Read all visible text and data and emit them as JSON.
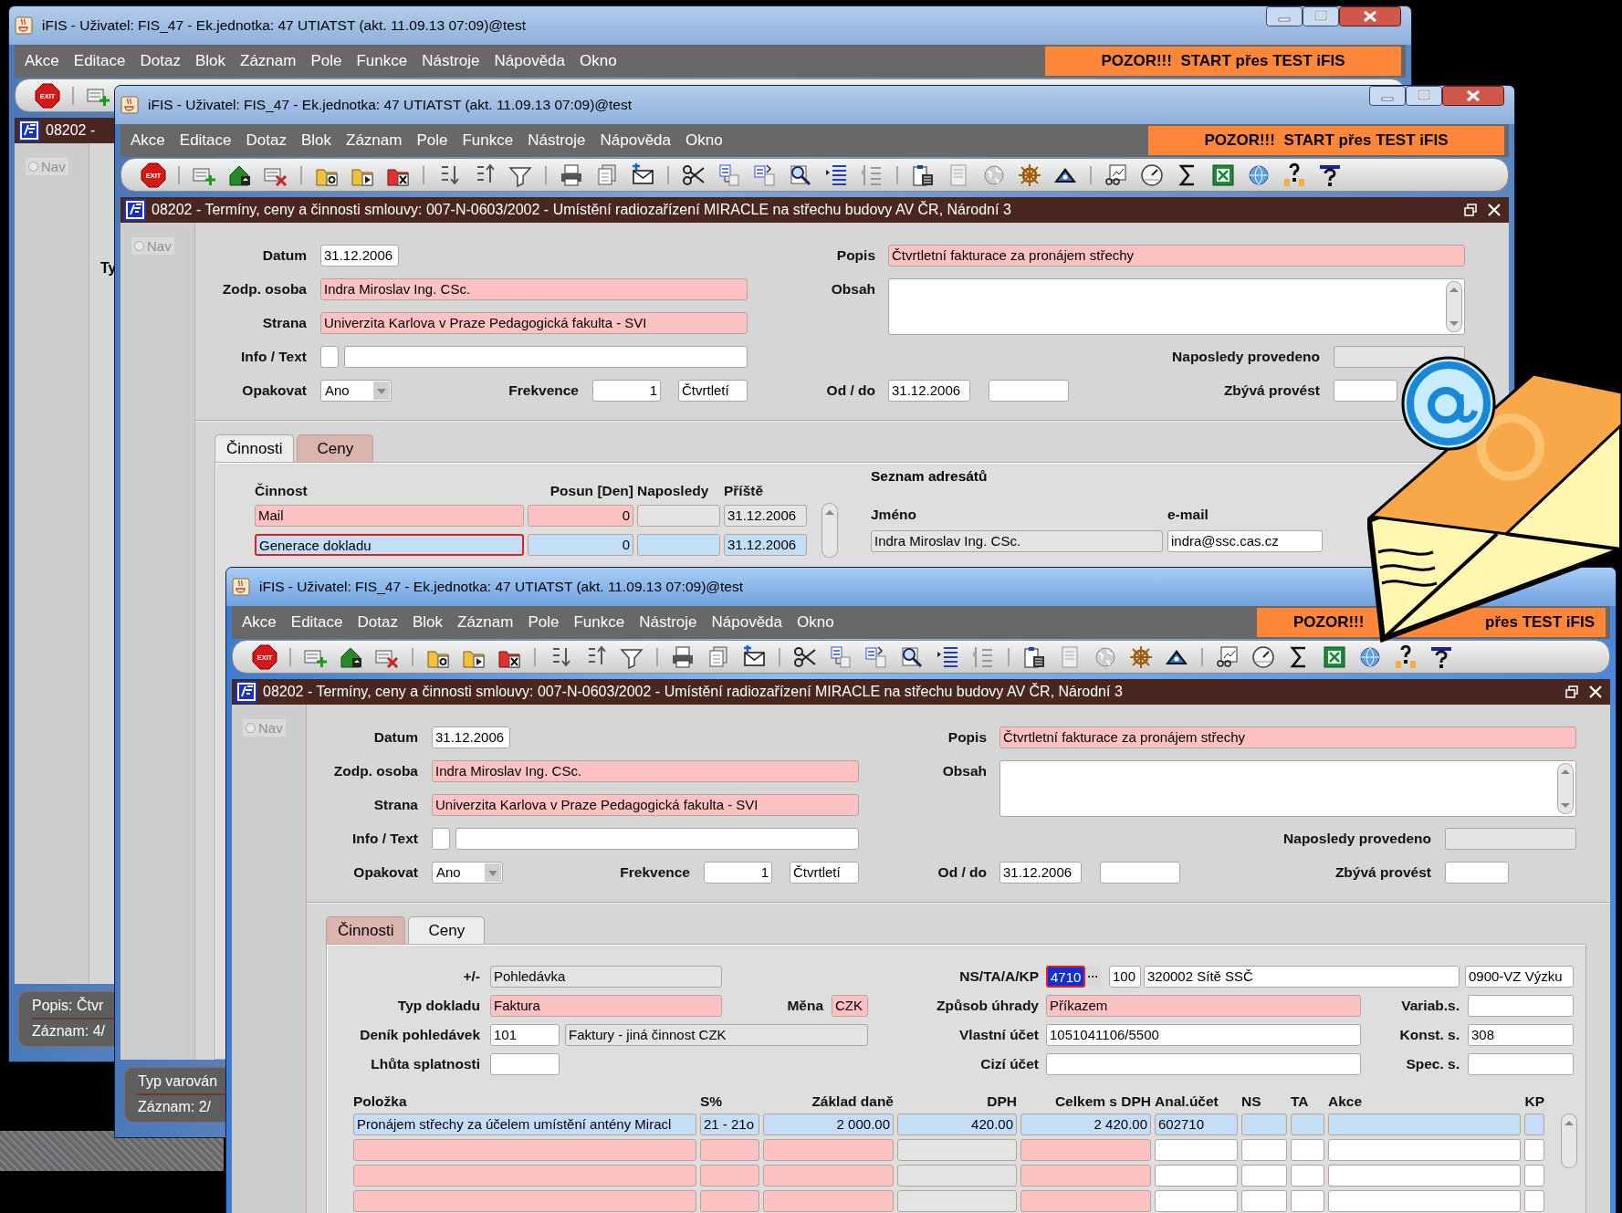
{
  "windows": [
    {
      "kind": "background",
      "active": false,
      "title": "iFIS - Uživatel: FIS_47 - Ek.jednotka: 47 UTIATST (akt. 11.09.13 07:09)@test",
      "title_buttons": true,
      "menu": [
        "Akce",
        "Editace",
        "Dotaz",
        "Blok",
        "Záznam",
        "Pole",
        "Funkce",
        "Nástroje",
        "Nápověda",
        "Okno"
      ],
      "banner": [
        "POZOR!!!  START přes TEST iFIS"
      ],
      "exit_label": "EXIT",
      "form_title": "08202 -",
      "nav": {
        "label": "Nav",
        "selected": false
      },
      "fragment": "Ty",
      "status": [
        "Popis: Čtvr",
        "Záznam: 4/"
      ]
    },
    {
      "kind": "form",
      "active": false,
      "title": "iFIS - Uživatel: FIS_47 - Ek.jednotka: 47 UTIATST (akt. 11.09.13 07:09)@test",
      "title_buttons": true,
      "menu": [
        "Akce",
        "Editace",
        "Dotaz",
        "Blok",
        "Záznam",
        "Pole",
        "Funkce",
        "Nástroje",
        "Nápověda",
        "Okno"
      ],
      "banner": [
        "POZOR!!!  START přes TEST iFIS"
      ],
      "exit_label": "EXIT",
      "form_title": "08202 - Termíny, ceny a činnosti smlouvy: 007-N-0603/2002 - Umístění radiozařízení MIRACLE na střechu budovy AV ČR, Národní 3",
      "nav": {
        "label": "Nav",
        "selected": false
      },
      "header": {
        "datum": {
          "label": "Datum",
          "value": "31.12.2006",
          "kind": "plain"
        },
        "osoba": {
          "label": "Zodp. osoba",
          "value": "Indra Miroslav Ing. CSc.",
          "kind": "required"
        },
        "strana": {
          "label": "Strana",
          "value": "Univerzita Karlova v Praze Pedagogická fakulta - SVI",
          "kind": "required"
        },
        "info": {
          "label": "Info / Text",
          "checked": false,
          "text": {
            "kind": "plain"
          }
        },
        "opakovat": {
          "label": "Opakovat",
          "value": "Ano",
          "kind": "plain"
        },
        "frekvence": {
          "label": "Frekvence",
          "value": "1",
          "kind": "plain",
          "unit": {
            "value": "Čtvrtletí",
            "kind": "plain"
          }
        },
        "popis": {
          "label": "Popis",
          "value": "Čtvrtletní fakturace za pronájem střechy",
          "kind": "required"
        },
        "obsah": {
          "label": "Obsah",
          "kind": "plain"
        },
        "naposledy": {
          "label": "Naposledy provedeno",
          "kind": "readonly"
        },
        "od_do": {
          "label": "Od / do",
          "from": {
            "value": "31.12.2006",
            "kind": "plain"
          },
          "to": {
            "kind": "plain"
          }
        },
        "zbyva": {
          "label": "Zbývá provést",
          "kind": "plain"
        }
      },
      "tabs": [
        {
          "label": "Činnosti",
          "selected": true
        },
        {
          "label": "Ceny",
          "selected": false
        }
      ],
      "panel": {
        "kind": "activities",
        "columns": [
          {
            "label": "Činnost",
            "kind": "required"
          },
          {
            "label": "Posun [Den]",
            "kind": "required"
          },
          {
            "label": "Naposledy",
            "kind": "readonly"
          },
          {
            "label": "Příště",
            "kind": "readonly"
          }
        ],
        "rows": [
          {
            "activity": "Mail",
            "shift": "0",
            "next": "31.12.2006",
            "selected": false
          },
          {
            "activity": "Generace dokladu",
            "shift": "0",
            "next": "31.12.2006",
            "selected": true
          }
        ],
        "recipients_title": "Seznam adresátů",
        "recipient_columns": [
          "Jméno",
          "e-mail"
        ],
        "recipients": [
          {
            "name": "Indra Miroslav Ing. CSc.",
            "email": "indra@ssc.cas.cz"
          }
        ]
      },
      "status": [
        "Typ varován",
        "Záznam: 2/"
      ]
    },
    {
      "kind": "form",
      "active": true,
      "title": "iFIS - Uživatel: FIS_47 - Ek.jednotka: 47 UTIATST (akt. 11.09.13 07:09)@test",
      "title_buttons": false,
      "menu": [
        "Akce",
        "Editace",
        "Dotaz",
        "Blok",
        "Záznam",
        "Pole",
        "Funkce",
        "Nástroje",
        "Nápověda",
        "Okno"
      ],
      "banner": [
        "POZOR!!!",
        "přes TEST iFIS"
      ],
      "exit_label": "EXIT",
      "form_title": "08202 - Termíny, ceny a činnosti smlouvy: 007-N-0603/2002 - Umístění radiozařízení MIRACLE na střechu budovy AV ČR, Národní 3",
      "nav": {
        "label": "Nav",
        "selected": false
      },
      "header": {
        "datum": {
          "label": "Datum",
          "value": "31.12.2006",
          "kind": "plain"
        },
        "osoba": {
          "label": "Zodp. osoba",
          "value": "Indra Miroslav Ing. CSc.",
          "kind": "required"
        },
        "strana": {
          "label": "Strana",
          "value": "Univerzita Karlova v Praze Pedagogická fakulta - SVI",
          "kind": "required"
        },
        "info": {
          "label": "Info / Text",
          "checked": false,
          "text": {
            "kind": "plain"
          }
        },
        "opakovat": {
          "label": "Opakovat",
          "value": "Ano",
          "kind": "plain"
        },
        "frekvence": {
          "label": "Frekvence",
          "value": "1",
          "kind": "plain",
          "unit": {
            "value": "Čtvrtletí",
            "kind": "plain"
          }
        },
        "popis": {
          "label": "Popis",
          "value": "Čtvrtletní fakturace za pronájem střechy",
          "kind": "required"
        },
        "obsah": {
          "label": "Obsah",
          "kind": "plain"
        },
        "naposledy": {
          "label": "Naposledy provedeno",
          "kind": "readonly"
        },
        "od_do": {
          "label": "Od / do",
          "from": {
            "value": "31.12.2006",
            "kind": "plain"
          },
          "to": {
            "kind": "plain"
          }
        },
        "zbyva": {
          "label": "Zbývá provést",
          "kind": "plain"
        }
      },
      "tabs": [
        {
          "label": "Činnosti",
          "selected": false
        },
        {
          "label": "Ceny",
          "selected": true
        }
      ],
      "panel": {
        "kind": "prices",
        "fields": {
          "znamenko": {
            "label": "+/-",
            "value": "Pohledávka",
            "kind": "readonly"
          },
          "typ": {
            "label": "Typ dokladu",
            "value": "Faktura",
            "kind": "required"
          },
          "mena": {
            "label": "Měna",
            "value": "CZK",
            "kind": "required"
          },
          "denik": {
            "label": "Deník pohledávek",
            "value": "101",
            "kind": "plain",
            "name": {
              "value": "Faktury - jiná činnost CZK",
              "kind": "readonly"
            }
          },
          "lhuta": {
            "label": "Lhůta splatnosti",
            "kind": "plain"
          },
          "ns": {
            "label": "NS/TA/A/KP",
            "values": [
              "4710",
              "100",
              "320002 Sítě SSČ",
              "0900-VZ Výzku"
            ],
            "button": "···",
            "focused": true
          },
          "zpusob": {
            "label": "Způsob úhrady",
            "value": "Příkazem",
            "kind": "required"
          },
          "vlastni": {
            "label": "Vlastní účet",
            "value": "1051041106/5500",
            "kind": "plain"
          },
          "cizi": {
            "label": "Cizí účet",
            "kind": "plain"
          },
          "variab": {
            "label": "Variab.s.",
            "kind": "plain"
          },
          "konst": {
            "label": "Konst. s.",
            "value": "308",
            "kind": "plain"
          },
          "spec": {
            "label": "Spec. s.",
            "kind": "plain"
          }
        },
        "columns": [
          {
            "label": "Položka",
            "kind": "required"
          },
          {
            "label": "S%",
            "kind": "required"
          },
          {
            "label": "Základ daně",
            "kind": "required"
          },
          {
            "label": "DPH",
            "kind": "readonly"
          },
          {
            "label": "Celkem s DPH",
            "kind": "required"
          },
          {
            "label": "Anal.účet",
            "kind": "plain"
          },
          {
            "label": "NS",
            "kind": "plain"
          },
          {
            "label": "TA",
            "kind": "plain"
          },
          {
            "label": "Akce",
            "kind": "plain"
          },
          {
            "label": "KP",
            "kind": "plain"
          }
        ],
        "rows": [
          {
            "selected": true,
            "cells": [
              "Pronájem střechy za účelem umístění antény Miracl",
              "21 - 21o",
              "2 000.00",
              "420.00",
              "2 420.00",
              "602710"
            ]
          },
          {
            "selected": false
          },
          {
            "selected": false
          },
          {
            "selected": false
          }
        ]
      }
    }
  ]
}
